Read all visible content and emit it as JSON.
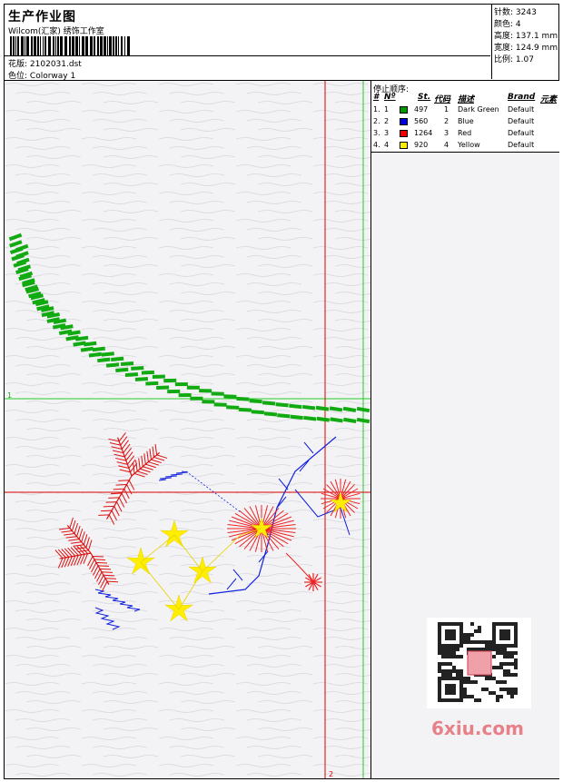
{
  "header": {
    "title": "生产作业图",
    "company": "Wilcom(汇家) 绣饰工作室",
    "design_label": "花版:",
    "design_value": "2102031.dst",
    "colorway_label": "色位:",
    "colorway_value": "Colorway 1"
  },
  "stats": {
    "stitches_label": "针数:",
    "stitches_value": "3243",
    "colors_label": "颜色:",
    "colors_value": "4",
    "height_label": "高度:",
    "height_value": "137.1 mm",
    "width_label": "宽度:",
    "width_value": "124.9 mm",
    "scale_label": "比例:",
    "scale_value": "1.07"
  },
  "stop_sequence": {
    "title": "停止顺序:",
    "columns": [
      "#",
      "Nº",
      "St.",
      "代码",
      "描述",
      "Brand",
      "元素"
    ],
    "rows": [
      {
        "num": "1.",
        "n": "1",
        "stitches": "497",
        "code": "1",
        "desc": "Dark Green",
        "brand": "Default",
        "color": "#009900"
      },
      {
        "num": "2.",
        "n": "2",
        "stitches": "560",
        "code": "2",
        "desc": "Blue",
        "brand": "Default",
        "color": "#0000dd"
      },
      {
        "num": "3.",
        "n": "3",
        "stitches": "1264",
        "code": "3",
        "desc": "Red",
        "brand": "Default",
        "color": "#ee0000"
      },
      {
        "num": "4.",
        "n": "4",
        "stitches": "920",
        "code": "4",
        "desc": "Yellow",
        "brand": "Default",
        "color": "#ffee00"
      }
    ]
  },
  "guides": {
    "h_label": "1",
    "v_label": "2"
  },
  "watermark": {
    "text": "6xiu.com"
  }
}
